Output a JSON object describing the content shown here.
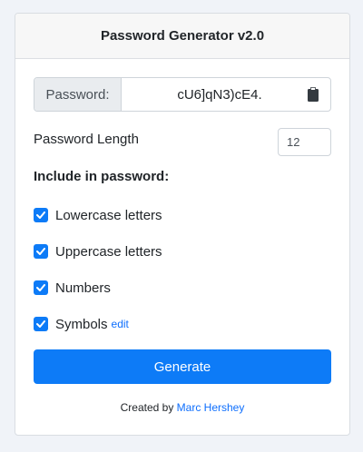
{
  "header": {
    "title": "Password Generator v2.0"
  },
  "password": {
    "prefix_label": "Password:",
    "value": "cU6]qN3)cE4.",
    "copy_icon": "clipboard-icon"
  },
  "length": {
    "label": "Password Length",
    "value": "12"
  },
  "options": {
    "title": "Include in password:",
    "items": [
      {
        "label": "Lowercase letters",
        "checked": true
      },
      {
        "label": "Uppercase letters",
        "checked": true
      },
      {
        "label": "Numbers",
        "checked": true
      },
      {
        "label": "Symbols",
        "checked": true,
        "edit_label": "edit"
      }
    ]
  },
  "generate": {
    "label": "Generate"
  },
  "footer": {
    "prefix": "Created by ",
    "author": "Marc Hershey"
  },
  "colors": {
    "accent": "#0d7bf7",
    "link": "#0d6efd",
    "background": "#f0f3f8"
  }
}
